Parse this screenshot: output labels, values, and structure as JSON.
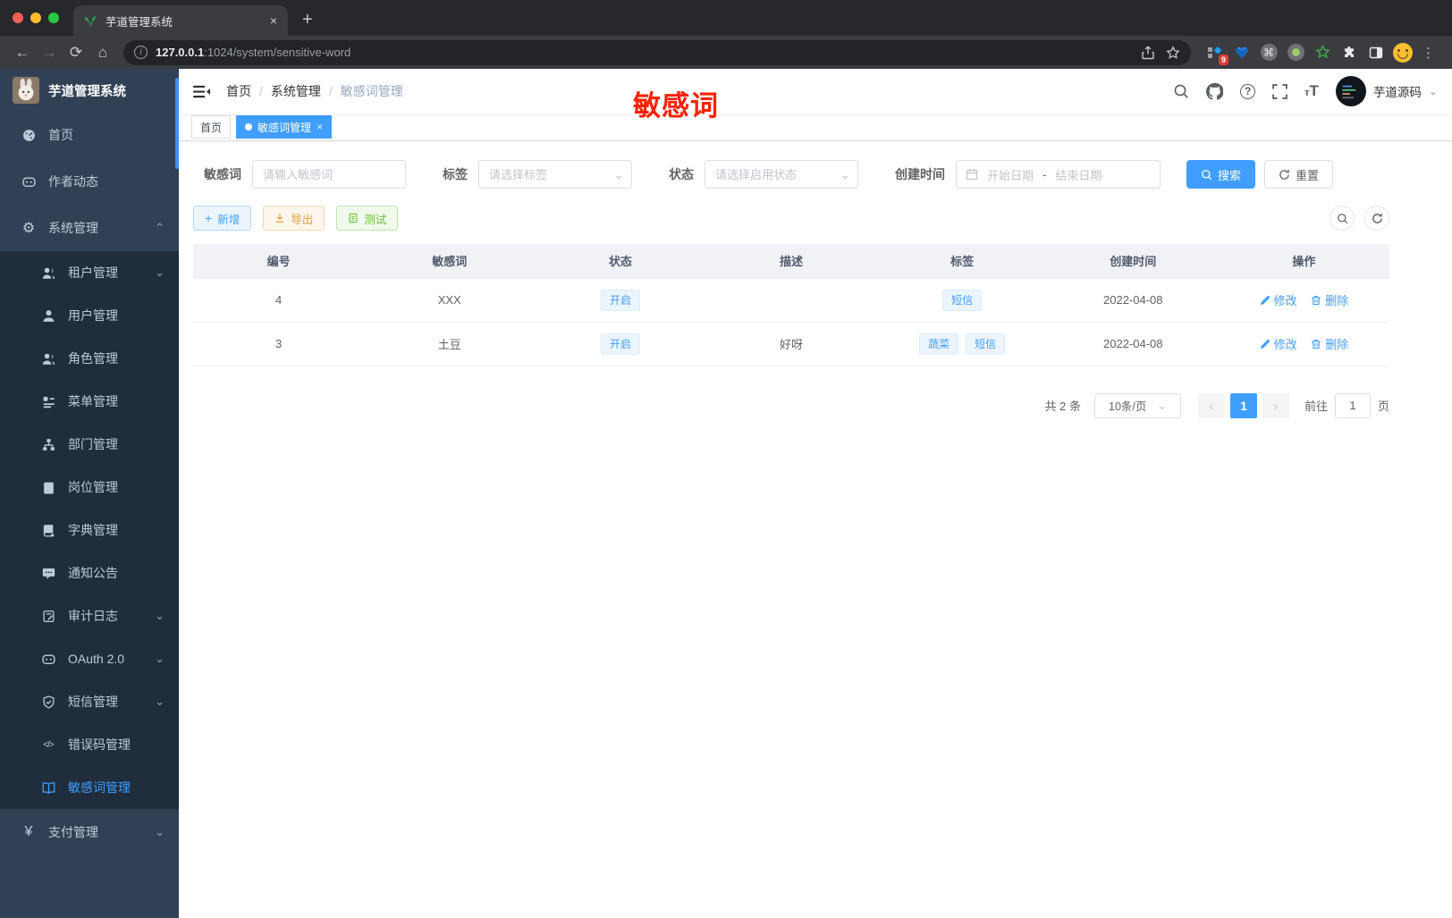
{
  "browser": {
    "tab_title": "芋道管理系统",
    "url_host": "127.0.0.1",
    "url_rest": ":1024/system/sensitive-word",
    "extension_badge": "9"
  },
  "glyphs": {
    "plus": "+",
    "close": "×",
    "slash": "/",
    "gear": "⚙",
    "yen": "¥",
    "code": "</>",
    "cmd": "⌘",
    "question": "?",
    "caret_down": "⌄",
    "chevron_up": "⌃",
    "chevron_down": "⌄",
    "ellipsis": "⋮",
    "prev": "‹",
    "next": "›",
    "font_big": "T",
    "font_small": "т",
    "info": "i"
  },
  "sidebar": {
    "title": "芋道管理系统",
    "items": [
      {
        "label": "首页"
      },
      {
        "label": "作者动态"
      },
      {
        "label": "系统管理"
      }
    ],
    "submenu": [
      {
        "label": "租户管理"
      },
      {
        "label": "用户管理"
      },
      {
        "label": "角色管理"
      },
      {
        "label": "菜单管理"
      },
      {
        "label": "部门管理"
      },
      {
        "label": "岗位管理"
      },
      {
        "label": "字典管理"
      },
      {
        "label": "通知公告"
      },
      {
        "label": "审计日志"
      },
      {
        "label": "OAuth 2.0"
      },
      {
        "label": "短信管理"
      },
      {
        "label": "错误码管理"
      },
      {
        "label": "敏感词管理"
      }
    ],
    "bottom": {
      "label": "支付管理"
    }
  },
  "header": {
    "breadcrumb": [
      "首页",
      "系统管理",
      "敏感词管理"
    ],
    "username": "芋道源码",
    "annotation": "敏感词"
  },
  "tabs": [
    {
      "label": "首页"
    },
    {
      "label": "敏感词管理"
    }
  ],
  "filters": {
    "keyword_label": "敏感词",
    "keyword_placeholder": "请输入敏感词",
    "tag_label": "标签",
    "tag_placeholder": "请选择标签",
    "status_label": "状态",
    "status_placeholder": "请选择启用状态",
    "date_label": "创建时间",
    "date_start_placeholder": "开始日期",
    "date_separator": "-",
    "date_end_placeholder": "结束日期",
    "search_label": "搜索",
    "reset_label": "重置"
  },
  "actions": {
    "add": "新增",
    "export": "导出",
    "test": "测试"
  },
  "table": {
    "columns": [
      "编号",
      "敏感词",
      "状态",
      "描述",
      "标签",
      "创建时间",
      "操作"
    ],
    "rows": [
      {
        "id": "4",
        "word": "XXX",
        "status": "开启",
        "desc": "",
        "tags": [
          "短信"
        ],
        "created": "2022-04-08",
        "edit": "修改",
        "delete": "删除"
      },
      {
        "id": "3",
        "word": "土豆",
        "status": "开启",
        "desc": "好呀",
        "tags": [
          "蔬菜",
          "短信"
        ],
        "created": "2022-04-08",
        "edit": "修改",
        "delete": "删除"
      }
    ]
  },
  "pagination": {
    "total": "共 2 条",
    "page_size": "10条/页",
    "current_page": "1",
    "goto_label": "前往",
    "goto_value": "1",
    "page_unit": "页"
  },
  "colors": {
    "primary": "#409eff",
    "warning": "#e6a23c",
    "success": "#67c23a",
    "annotation_red": "#ff2000",
    "sidebar_bg": "#304156",
    "sidebar_submenu_bg": "#1f2d3d",
    "active_tag": "#409eff",
    "mac_close": "#ff5f57",
    "mac_minimize": "#febc2e",
    "mac_zoom": "#28c840"
  }
}
